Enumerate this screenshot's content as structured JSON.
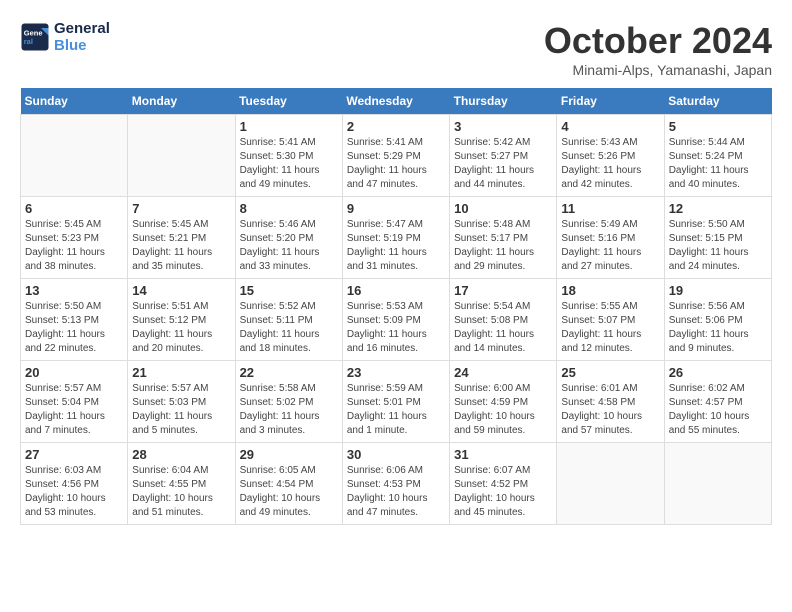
{
  "header": {
    "logo_line1": "General",
    "logo_line2": "Blue",
    "month_title": "October 2024",
    "subtitle": "Minami-Alps, Yamanashi, Japan"
  },
  "days_of_week": [
    "Sunday",
    "Monday",
    "Tuesday",
    "Wednesday",
    "Thursday",
    "Friday",
    "Saturday"
  ],
  "weeks": [
    [
      {
        "day": "",
        "sunrise": "",
        "sunset": "",
        "daylight": ""
      },
      {
        "day": "",
        "sunrise": "",
        "sunset": "",
        "daylight": ""
      },
      {
        "day": "1",
        "sunrise": "Sunrise: 5:41 AM",
        "sunset": "Sunset: 5:30 PM",
        "daylight": "Daylight: 11 hours and 49 minutes."
      },
      {
        "day": "2",
        "sunrise": "Sunrise: 5:41 AM",
        "sunset": "Sunset: 5:29 PM",
        "daylight": "Daylight: 11 hours and 47 minutes."
      },
      {
        "day": "3",
        "sunrise": "Sunrise: 5:42 AM",
        "sunset": "Sunset: 5:27 PM",
        "daylight": "Daylight: 11 hours and 44 minutes."
      },
      {
        "day": "4",
        "sunrise": "Sunrise: 5:43 AM",
        "sunset": "Sunset: 5:26 PM",
        "daylight": "Daylight: 11 hours and 42 minutes."
      },
      {
        "day": "5",
        "sunrise": "Sunrise: 5:44 AM",
        "sunset": "Sunset: 5:24 PM",
        "daylight": "Daylight: 11 hours and 40 minutes."
      }
    ],
    [
      {
        "day": "6",
        "sunrise": "Sunrise: 5:45 AM",
        "sunset": "Sunset: 5:23 PM",
        "daylight": "Daylight: 11 hours and 38 minutes."
      },
      {
        "day": "7",
        "sunrise": "Sunrise: 5:45 AM",
        "sunset": "Sunset: 5:21 PM",
        "daylight": "Daylight: 11 hours and 35 minutes."
      },
      {
        "day": "8",
        "sunrise": "Sunrise: 5:46 AM",
        "sunset": "Sunset: 5:20 PM",
        "daylight": "Daylight: 11 hours and 33 minutes."
      },
      {
        "day": "9",
        "sunrise": "Sunrise: 5:47 AM",
        "sunset": "Sunset: 5:19 PM",
        "daylight": "Daylight: 11 hours and 31 minutes."
      },
      {
        "day": "10",
        "sunrise": "Sunrise: 5:48 AM",
        "sunset": "Sunset: 5:17 PM",
        "daylight": "Daylight: 11 hours and 29 minutes."
      },
      {
        "day": "11",
        "sunrise": "Sunrise: 5:49 AM",
        "sunset": "Sunset: 5:16 PM",
        "daylight": "Daylight: 11 hours and 27 minutes."
      },
      {
        "day": "12",
        "sunrise": "Sunrise: 5:50 AM",
        "sunset": "Sunset: 5:15 PM",
        "daylight": "Daylight: 11 hours and 24 minutes."
      }
    ],
    [
      {
        "day": "13",
        "sunrise": "Sunrise: 5:50 AM",
        "sunset": "Sunset: 5:13 PM",
        "daylight": "Daylight: 11 hours and 22 minutes."
      },
      {
        "day": "14",
        "sunrise": "Sunrise: 5:51 AM",
        "sunset": "Sunset: 5:12 PM",
        "daylight": "Daylight: 11 hours and 20 minutes."
      },
      {
        "day": "15",
        "sunrise": "Sunrise: 5:52 AM",
        "sunset": "Sunset: 5:11 PM",
        "daylight": "Daylight: 11 hours and 18 minutes."
      },
      {
        "day": "16",
        "sunrise": "Sunrise: 5:53 AM",
        "sunset": "Sunset: 5:09 PM",
        "daylight": "Daylight: 11 hours and 16 minutes."
      },
      {
        "day": "17",
        "sunrise": "Sunrise: 5:54 AM",
        "sunset": "Sunset: 5:08 PM",
        "daylight": "Daylight: 11 hours and 14 minutes."
      },
      {
        "day": "18",
        "sunrise": "Sunrise: 5:55 AM",
        "sunset": "Sunset: 5:07 PM",
        "daylight": "Daylight: 11 hours and 12 minutes."
      },
      {
        "day": "19",
        "sunrise": "Sunrise: 5:56 AM",
        "sunset": "Sunset: 5:06 PM",
        "daylight": "Daylight: 11 hours and 9 minutes."
      }
    ],
    [
      {
        "day": "20",
        "sunrise": "Sunrise: 5:57 AM",
        "sunset": "Sunset: 5:04 PM",
        "daylight": "Daylight: 11 hours and 7 minutes."
      },
      {
        "day": "21",
        "sunrise": "Sunrise: 5:57 AM",
        "sunset": "Sunset: 5:03 PM",
        "daylight": "Daylight: 11 hours and 5 minutes."
      },
      {
        "day": "22",
        "sunrise": "Sunrise: 5:58 AM",
        "sunset": "Sunset: 5:02 PM",
        "daylight": "Daylight: 11 hours and 3 minutes."
      },
      {
        "day": "23",
        "sunrise": "Sunrise: 5:59 AM",
        "sunset": "Sunset: 5:01 PM",
        "daylight": "Daylight: 11 hours and 1 minute."
      },
      {
        "day": "24",
        "sunrise": "Sunrise: 6:00 AM",
        "sunset": "Sunset: 4:59 PM",
        "daylight": "Daylight: 10 hours and 59 minutes."
      },
      {
        "day": "25",
        "sunrise": "Sunrise: 6:01 AM",
        "sunset": "Sunset: 4:58 PM",
        "daylight": "Daylight: 10 hours and 57 minutes."
      },
      {
        "day": "26",
        "sunrise": "Sunrise: 6:02 AM",
        "sunset": "Sunset: 4:57 PM",
        "daylight": "Daylight: 10 hours and 55 minutes."
      }
    ],
    [
      {
        "day": "27",
        "sunrise": "Sunrise: 6:03 AM",
        "sunset": "Sunset: 4:56 PM",
        "daylight": "Daylight: 10 hours and 53 minutes."
      },
      {
        "day": "28",
        "sunrise": "Sunrise: 6:04 AM",
        "sunset": "Sunset: 4:55 PM",
        "daylight": "Daylight: 10 hours and 51 minutes."
      },
      {
        "day": "29",
        "sunrise": "Sunrise: 6:05 AM",
        "sunset": "Sunset: 4:54 PM",
        "daylight": "Daylight: 10 hours and 49 minutes."
      },
      {
        "day": "30",
        "sunrise": "Sunrise: 6:06 AM",
        "sunset": "Sunset: 4:53 PM",
        "daylight": "Daylight: 10 hours and 47 minutes."
      },
      {
        "day": "31",
        "sunrise": "Sunrise: 6:07 AM",
        "sunset": "Sunset: 4:52 PM",
        "daylight": "Daylight: 10 hours and 45 minutes."
      },
      {
        "day": "",
        "sunrise": "",
        "sunset": "",
        "daylight": ""
      },
      {
        "day": "",
        "sunrise": "",
        "sunset": "",
        "daylight": ""
      }
    ]
  ]
}
